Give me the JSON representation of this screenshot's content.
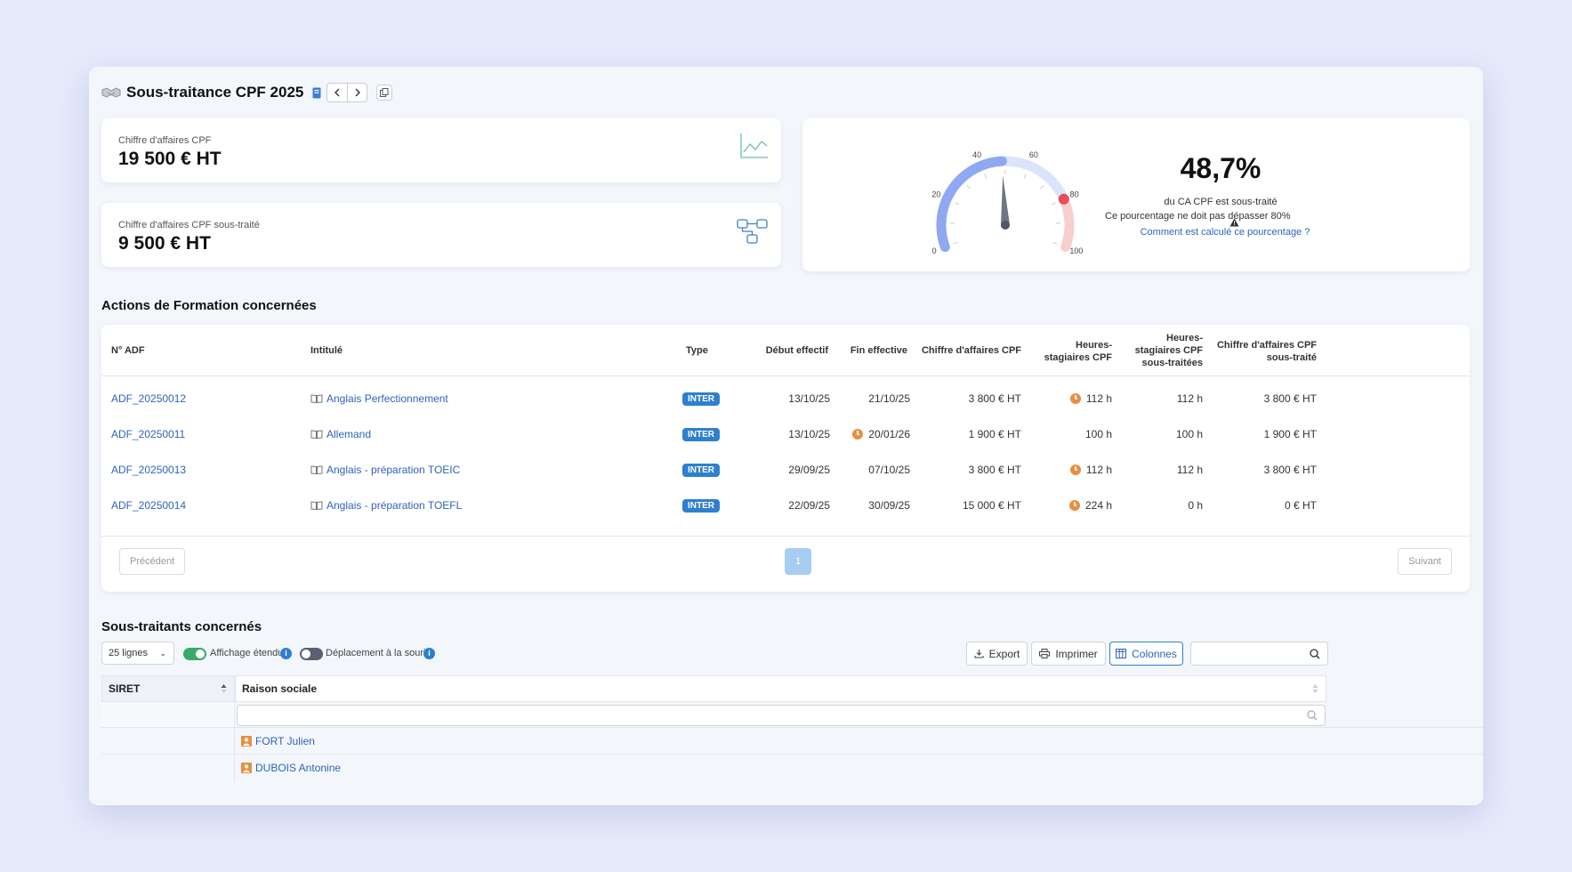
{
  "header": {
    "title": "Sous-traitance CPF 2025"
  },
  "kpis": [
    {
      "label": "Chiffre d'affaires CPF",
      "value": "19 500 € HT",
      "icon": "line-chart-icon"
    },
    {
      "label": "Chiffre d'affaires CPF sous-traité",
      "value": "9 500 € HT",
      "icon": "network-icon"
    }
  ],
  "gauge": {
    "value": 48.7,
    "percent": "48,7%",
    "subtitle": "du CA CPF est sous-traité",
    "warning": "Ce pourcentage ne doit pas dépasser 80%",
    "link": "Comment est calculé ce pourcentage ?",
    "threshold": 80,
    "ticks": [
      "0",
      "20",
      "40",
      "60",
      "80",
      "100"
    ],
    "colors": {
      "fill": "#8fa8f2",
      "track": "#dce4fb",
      "danger": "#f7cfcf",
      "marker": "#e84d58"
    }
  },
  "actions": {
    "title": "Actions de Formation concernées",
    "columns": [
      "N° ADF",
      "Intitulé",
      "Type",
      "Début effectif",
      "Fin effective",
      "Chiffre d'affaires CPF",
      "Heures-stagiaires CPF",
      "Heures-stagiaires CPF sous-traitées",
      "Chiffre d'affaires CPF sous-traité"
    ],
    "rows": [
      {
        "adf": "ADF_20250012",
        "intitule": "Anglais Perfectionnement",
        "type": "INTER",
        "debut": "13/10/25",
        "fin": "21/10/25",
        "ca": "3 800 € HT",
        "heures": "112 h",
        "heures_st": "112 h",
        "ca_st": "3 800 € HT"
      },
      {
        "adf": "ADF_20250011",
        "intitule": "Allemand",
        "type": "INTER",
        "debut": "13/10/25",
        "fin": "20/01/26",
        "ca": "1 900 € HT",
        "heures": "100 h",
        "heures_st": "100 h",
        "ca_st": "1 900 € HT"
      },
      {
        "adf": "ADF_20250013",
        "intitule": "Anglais - préparation TOEIC",
        "type": "INTER",
        "debut": "29/09/25",
        "fin": "07/10/25",
        "ca": "3 800 € HT",
        "heures": "112 h",
        "heures_st": "112 h",
        "ca_st": "3 800 € HT"
      },
      {
        "adf": "ADF_20250014",
        "intitule": "Anglais - préparation TOEFL",
        "type": "INTER",
        "debut": "22/09/25",
        "fin": "30/09/25",
        "ca": "15 000 € HT",
        "heures": "224 h",
        "heures_st": "0 h",
        "ca_st": "0 € HT"
      }
    ],
    "pagination": {
      "prev": "Précédent",
      "page": "1",
      "next": "Suivant"
    }
  },
  "subcontractors": {
    "title": "Sous-traitants concernés",
    "page_size": "25 lignes",
    "toggle_extended": "Affichage étendu",
    "toggle_mouse": "Déplacement à la souris",
    "buttons": {
      "export": "Export",
      "print": "Imprimer",
      "columns": "Colonnes"
    },
    "columns": [
      "SIRET",
      "Raison sociale"
    ],
    "rows": [
      {
        "siret": "",
        "name": "FORT Julien"
      },
      {
        "siret": "",
        "name": "DUBOIS Antonine"
      }
    ]
  },
  "colors": {
    "accent": "#2f7fd0",
    "link": "#2f64b8",
    "badge": "#2f7fd0",
    "clock": "#e88f3f",
    "toggle_on": "#3aaa6a",
    "toggle_off": "#5a6270"
  }
}
